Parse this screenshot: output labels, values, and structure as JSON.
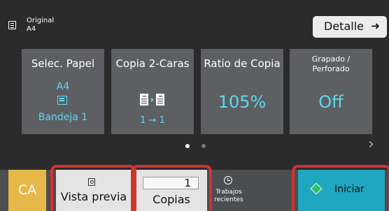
{
  "header": {
    "original_label": "Original",
    "original_size": "A4",
    "detail_button": "Detalle",
    "detail_arrow": "➜"
  },
  "tiles": {
    "paper": {
      "title": "Selec. Papel",
      "size": "A4",
      "tray": "Bandeja 1",
      "icon": "paper-tray-icon"
    },
    "duplex": {
      "title": "Copia 2-Caras",
      "mode": "1 → 1",
      "icon": "duplex-copy-icon"
    },
    "ratio": {
      "title": "Ratio de Copia",
      "value": "105%"
    },
    "staple": {
      "title_line1": "Grapado /",
      "title_line2": "Perforado",
      "value": "Off"
    }
  },
  "pager": {
    "active_color": "#ffffff",
    "inactive_color": "#777777",
    "next": "›"
  },
  "bottom": {
    "ca": "CA",
    "preview": "Vista previa",
    "copies_value": "1",
    "copies_label": "Copias",
    "recent_line1": "Trabajos",
    "recent_line2": "recientes",
    "start": "Iniciar"
  },
  "colors": {
    "accent_cyan": "#5dd7ec",
    "start_button": "#1fa6c0",
    "clear_all": "#e6b84a",
    "highlight": "#d2322e",
    "start_diamond": "#2ec16c"
  }
}
